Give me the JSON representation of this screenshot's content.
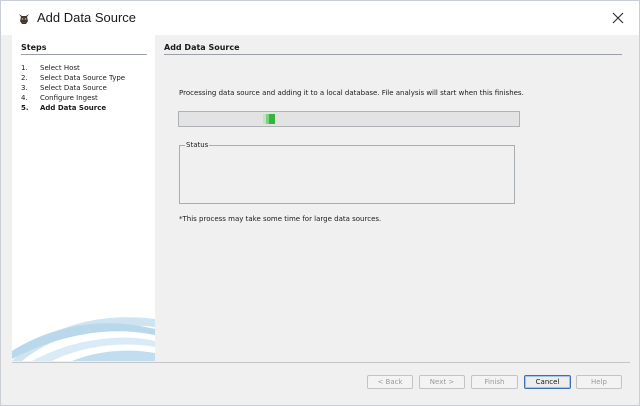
{
  "window": {
    "title": "Add Data Source"
  },
  "icons": {
    "app": "autopsy-dog-icon",
    "close": "close-icon"
  },
  "steps": {
    "heading": "Steps",
    "items": [
      {
        "num": "1.",
        "label": "Select Host",
        "current": false
      },
      {
        "num": "2.",
        "label": "Select Data Source Type",
        "current": false
      },
      {
        "num": "3.",
        "label": "Select Data Source",
        "current": false
      },
      {
        "num": "4.",
        "label": "Configure Ingest",
        "current": false
      },
      {
        "num": "5.",
        "label": "Add Data Source",
        "current": true
      }
    ]
  },
  "content": {
    "title": "Add Data Source",
    "processing": "Processing data source and adding it to a local database. File analysis will start when this finishes.",
    "progress_state": "indeterminate",
    "status_legend": "Status",
    "status_text": "",
    "note": "*This process may take some time for large data sources."
  },
  "buttons": {
    "back": "< Back",
    "next": "Next >",
    "finish": "Finish",
    "cancel": "Cancel",
    "help": "Help"
  },
  "colors": {
    "progress": "#35b53a",
    "accent": "#3b6fb6"
  }
}
